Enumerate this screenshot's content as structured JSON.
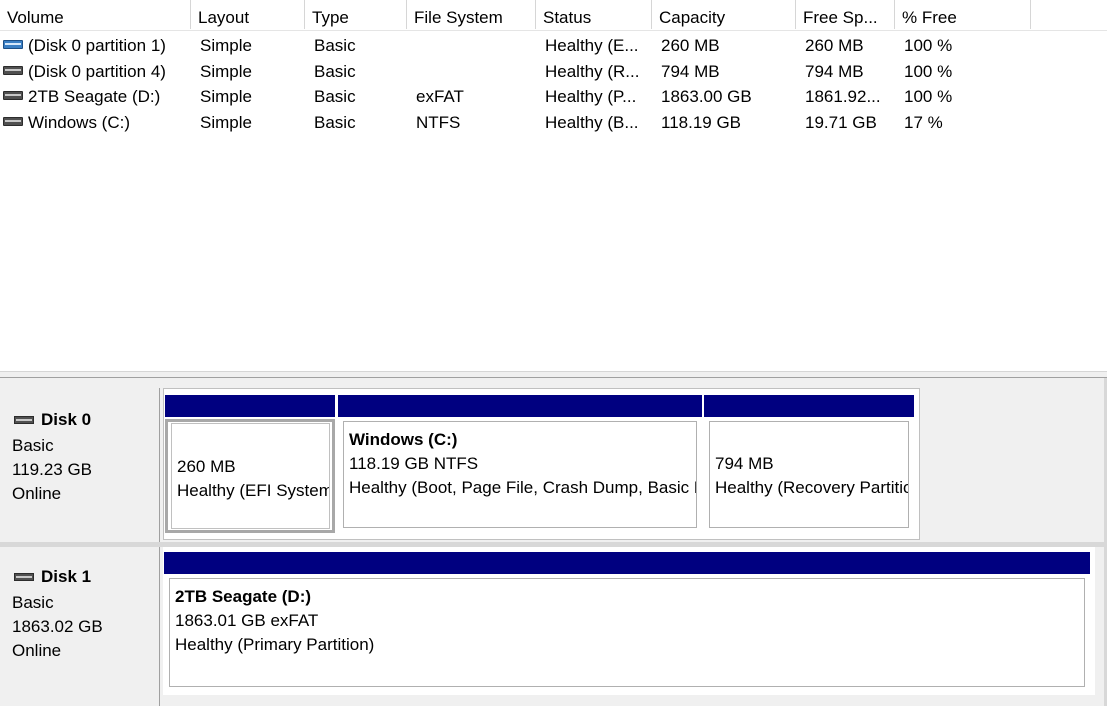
{
  "columns": [
    "Volume",
    "Layout",
    "Type",
    "File System",
    "Status",
    "Capacity",
    "Free Sp...",
    "% Free"
  ],
  "volumes": [
    {
      "icon": "blue-drive-icon",
      "volume": "(Disk 0 partition 1)",
      "layout": "Simple",
      "type": "Basic",
      "fs": "",
      "status": "Healthy (E...",
      "capacity": "260 MB",
      "free": "260 MB",
      "pct": "100 %"
    },
    {
      "icon": "drive-icon",
      "volume": "(Disk 0 partition 4)",
      "layout": "Simple",
      "type": "Basic",
      "fs": "",
      "status": "Healthy (R...",
      "capacity": "794 MB",
      "free": "794 MB",
      "pct": "100 %"
    },
    {
      "icon": "drive-icon",
      "volume": "2TB Seagate (D:)",
      "layout": "Simple",
      "type": "Basic",
      "fs": "exFAT",
      "status": "Healthy (P...",
      "capacity": "1863.00 GB",
      "free": "1861.92...",
      "pct": "100 %"
    },
    {
      "icon": "drive-icon",
      "volume": "Windows (C:)",
      "layout": "Simple",
      "type": "Basic",
      "fs": "NTFS",
      "status": "Healthy (B...",
      "capacity": "118.19 GB",
      "free": "19.71 GB",
      "pct": "17 %"
    }
  ],
  "disks": [
    {
      "name": "Disk 0",
      "type": "Basic",
      "size": "119.23 GB",
      "state": "Online",
      "partitions": [
        {
          "title": "",
          "size": "260 MB",
          "status": "Healthy (EFI System Partition)"
        },
        {
          "title": "Windows  (C:)",
          "size": "118.19 GB NTFS",
          "status": "Healthy (Boot, Page File, Crash Dump, Basic Data Partition)"
        },
        {
          "title": "",
          "size": "794 MB",
          "status": "Healthy (Recovery Partition)"
        }
      ]
    },
    {
      "name": "Disk 1",
      "type": "Basic",
      "size": "1863.02 GB",
      "state": "Online",
      "partitions": [
        {
          "title": "2TB Seagate  (D:)",
          "size": "1863.01 GB exFAT",
          "status": "Healthy (Primary Partition)"
        }
      ]
    }
  ],
  "colors": {
    "partition_bar": "#000080",
    "panel_bg": "#f0f0f0"
  }
}
